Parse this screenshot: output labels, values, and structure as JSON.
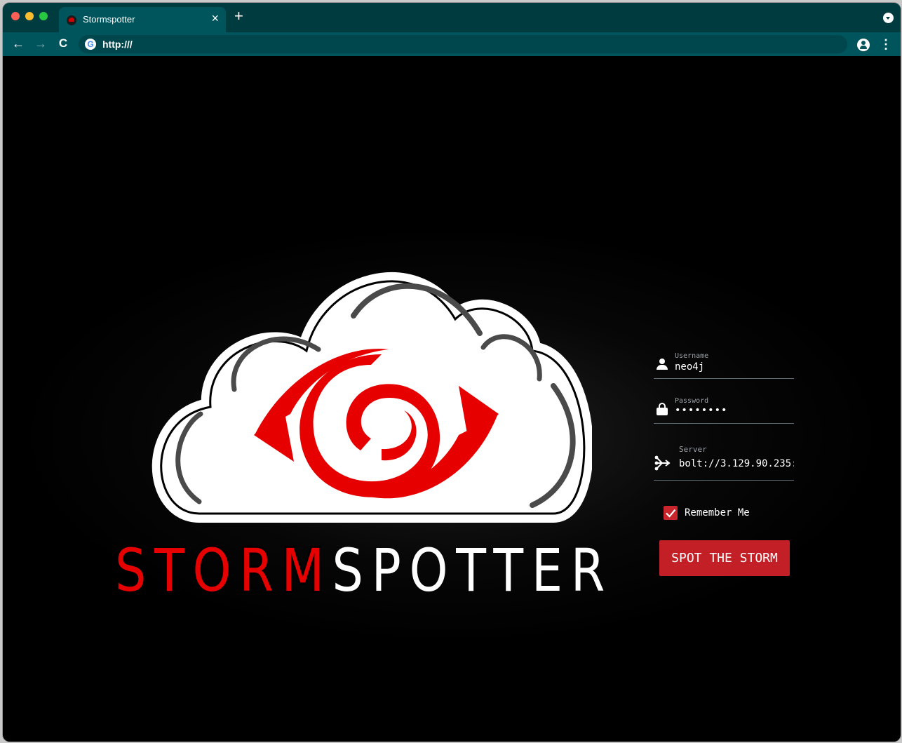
{
  "browser": {
    "tab_title": "Stormspotter",
    "tab_close": "×",
    "new_tab": "+",
    "url": "http:///",
    "nav": {
      "back": "←",
      "forward": "→",
      "reload": "C"
    },
    "menu": "⋮"
  },
  "brand": {
    "wordmark_red": "STORM",
    "wordmark_white": "SPOTTER",
    "colors": {
      "red": "#e60000",
      "cloud": "#ffffff",
      "cloud_outline": "#4a4a4a",
      "accent": "#c21f26"
    }
  },
  "login": {
    "username": {
      "label": "Username",
      "value": "neo4j"
    },
    "password": {
      "label": "Password",
      "value": "••••••••"
    },
    "server": {
      "label": "Server",
      "value": "bolt://3.129.90.235:"
    },
    "remember_me": {
      "label": "Remember Me",
      "checked": true
    },
    "submit": "SPOT THE STORM"
  },
  "icons": {
    "username": "person-icon",
    "password": "lock-icon",
    "server": "server-connection-icon",
    "checkbox": "checkmark-icon",
    "favicon": "stormspotter-favicon",
    "omnibox": "google-icon"
  }
}
